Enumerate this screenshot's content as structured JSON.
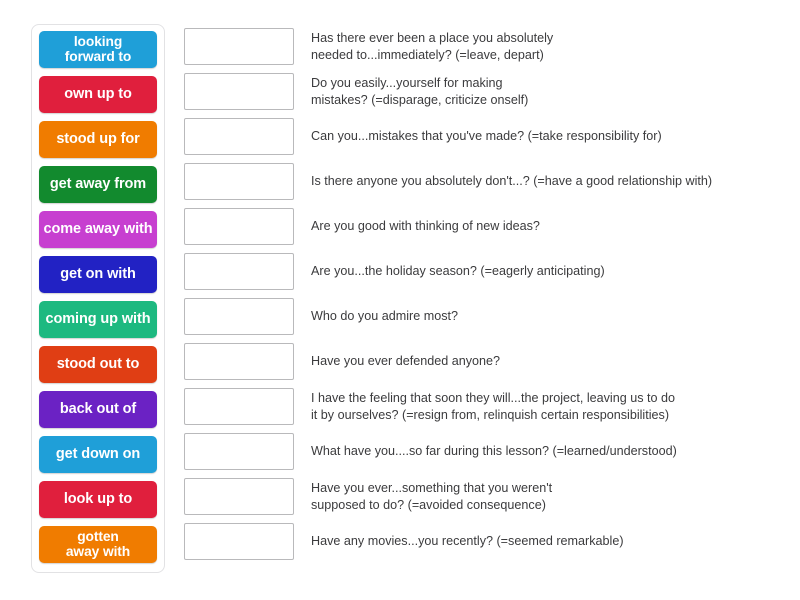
{
  "activity": {
    "type": "match-up-drag-and-drop",
    "tiles": [
      {
        "label": "looking\nforward to",
        "color": "#1f9fd8",
        "lines": 2
      },
      {
        "label": "own up to",
        "color": "#e01f3d",
        "lines": 1
      },
      {
        "label": "stood up for",
        "color": "#f07c00",
        "lines": 1
      },
      {
        "label": "get away from",
        "color": "#128a2e",
        "lines": 1
      },
      {
        "label": "come away with",
        "color": "#c73fd0",
        "lines": 1
      },
      {
        "label": "get on with",
        "color": "#2222c4",
        "lines": 1
      },
      {
        "label": "coming up with",
        "color": "#1db980",
        "lines": 1
      },
      {
        "label": "stood out to",
        "color": "#e03e14",
        "lines": 1
      },
      {
        "label": "back out of",
        "color": "#6b22c4",
        "lines": 1
      },
      {
        "label": "get down on",
        "color": "#1f9fd8",
        "lines": 1
      },
      {
        "label": "look up to",
        "color": "#e01f3d",
        "lines": 1
      },
      {
        "label": "gotten\naway with",
        "color": "#f07c00",
        "lines": 2
      }
    ],
    "rows": [
      {
        "answer": "",
        "question": "Has there ever been a place you absolutely\nneeded to...immediately?  (=leave, depart)"
      },
      {
        "answer": "",
        "question": "Do you easily...yourself  for making\nmistakes? (=disparage, criticize onself)"
      },
      {
        "answer": "",
        "question": "Can you...mistakes  that you've made? (=take responsibility  for)"
      },
      {
        "answer": "",
        "question": "Is there anyone you absolutely  don't...? (=have a good relationship  with)"
      },
      {
        "answer": "",
        "question": "Are you good with thinking  of new ideas?"
      },
      {
        "answer": "",
        "question": "Are you...the holiday  season? (=eagerly  anticipating)"
      },
      {
        "answer": "",
        "question": "Who do you admire most?"
      },
      {
        "answer": "",
        "question": "Have you ever defended anyone?"
      },
      {
        "answer": "",
        "question": "I have the feeling that soon they will...the  project, leaving us to do\nit by ourselves? (=resign from, relinquish  certain responsibilities)"
      },
      {
        "answer": "",
        "question": "What have you....so far during this lesson? (=learned/understood)"
      },
      {
        "answer": "",
        "question": "Have you ever...something  that you weren't\nsupposed to do? (=avoided  consequence)"
      },
      {
        "answer": "",
        "question": "Have any movies...you  recently? (=seemed  remarkable)"
      }
    ]
  }
}
